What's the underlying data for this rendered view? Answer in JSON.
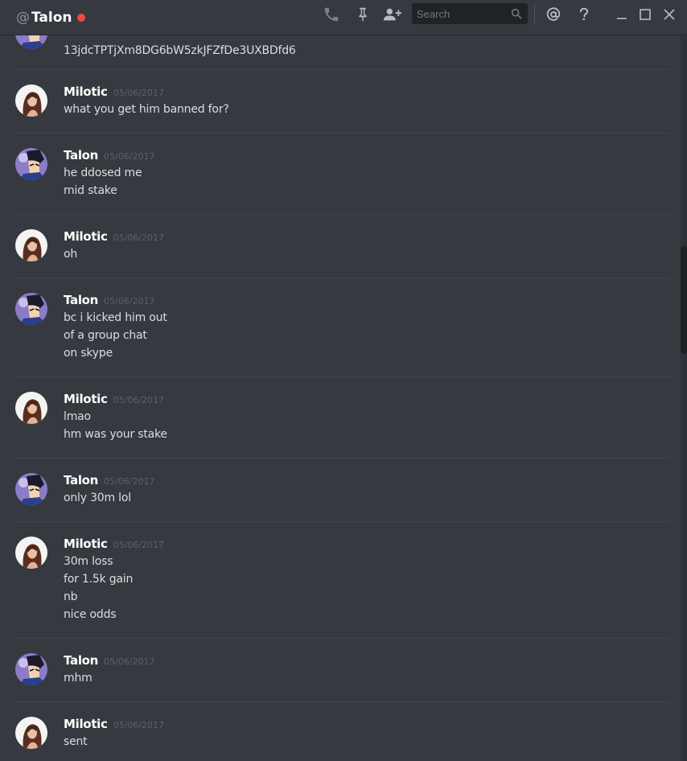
{
  "header": {
    "at_symbol": "@",
    "channel_name": "Talon",
    "status_color": "#f04747",
    "icons": [
      "phone-icon",
      "pin-icon",
      "add-friend-icon",
      "mention-icon",
      "help-icon",
      "minimize-icon",
      "maximize-icon",
      "close-icon"
    ]
  },
  "search": {
    "placeholder": "Search"
  },
  "messages": {
    "m0": {
      "line1": "13jdcTPTjXm8DG6bW5zkJFZfDe3UXBDfd6"
    },
    "m1": {
      "user": "Milotic",
      "time": "05/06/2017",
      "line1": "what you get him banned for?"
    },
    "m2": {
      "user": "Talon",
      "time": "05/06/2017",
      "line1": "he ddosed me",
      "line2": "mid stake"
    },
    "m3": {
      "user": "Milotic",
      "time": "05/06/2017",
      "line1": "oh"
    },
    "m4": {
      "user": "Talon",
      "time": "05/06/2017",
      "line1": "bc i kicked him out",
      "line2": "of a group chat",
      "line3": "on skype"
    },
    "m5": {
      "user": "Milotic",
      "time": "05/06/2017",
      "line1": "lmao",
      "line2": "hm was your stake"
    },
    "m6": {
      "user": "Talon",
      "time": "05/06/2017",
      "line1": "only 30m lol"
    },
    "m7": {
      "user": "Milotic",
      "time": "05/06/2017",
      "line1": "30m loss",
      "line2": "for 1.5k gain",
      "line3": "nb",
      "line4": "nice odds"
    },
    "m8": {
      "user": "Talon",
      "time": "05/06/2017",
      "line1": "mhm"
    },
    "m9": {
      "user": "Milotic",
      "time": "05/06/2017",
      "line1": "sent"
    }
  },
  "colors": {
    "background": "#36393f",
    "username": "#ffffff",
    "timestamp": "#5d6066",
    "text": "#dcddde"
  }
}
